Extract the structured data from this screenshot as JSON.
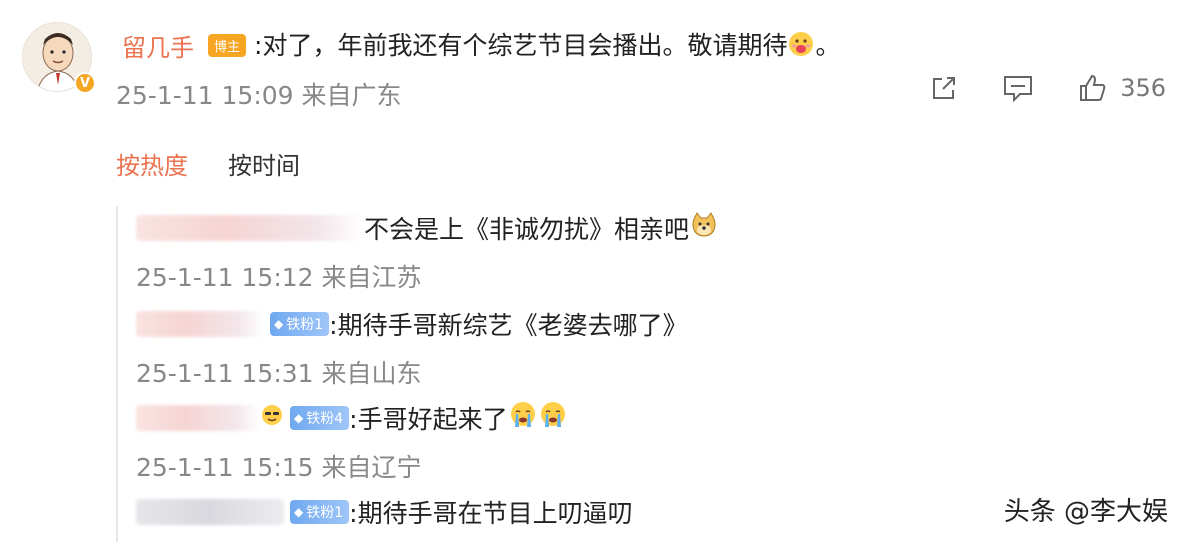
{
  "post": {
    "author": "留几手",
    "author_badge": "博主",
    "text": ":对了，年前我还有个综艺节目会播出。敬请期待",
    "text_tail": "。",
    "emoji": "drooling-face-emoji",
    "meta": "25-1-11 15:09 来自广东",
    "actions": {
      "share_icon": "share-icon",
      "comment_icon": "comment-icon",
      "like_icon": "thumbs-up-icon",
      "like_count": "356"
    }
  },
  "sort_tabs": {
    "hot": "按热度",
    "time": "按时间"
  },
  "comments": [
    {
      "text": "不会是上《非诚勿扰》相亲吧",
      "emoji": "doge-emoji",
      "meta": "25-1-11 15:12 来自江苏"
    },
    {
      "fan_badge": "铁粉1",
      "text": ":期待手哥新综艺《老婆去哪了》",
      "meta": "25-1-11 15:31 来自山东"
    },
    {
      "fan_badge": "铁粉4",
      "text": ":手哥好起来了",
      "emoji": "crying-face-emoji",
      "meta": "25-1-11 15:15 来自辽宁"
    },
    {
      "fan_badge": "铁粉1",
      "text": ":期待手哥在节目上叨逼叨"
    }
  ],
  "watermark": "头条 @李大娱",
  "colors": {
    "accent": "#eb7350",
    "badge_orange": "#f7a623",
    "fan_badge_blue": "#6fa8f0",
    "meta_gray": "#888888"
  }
}
